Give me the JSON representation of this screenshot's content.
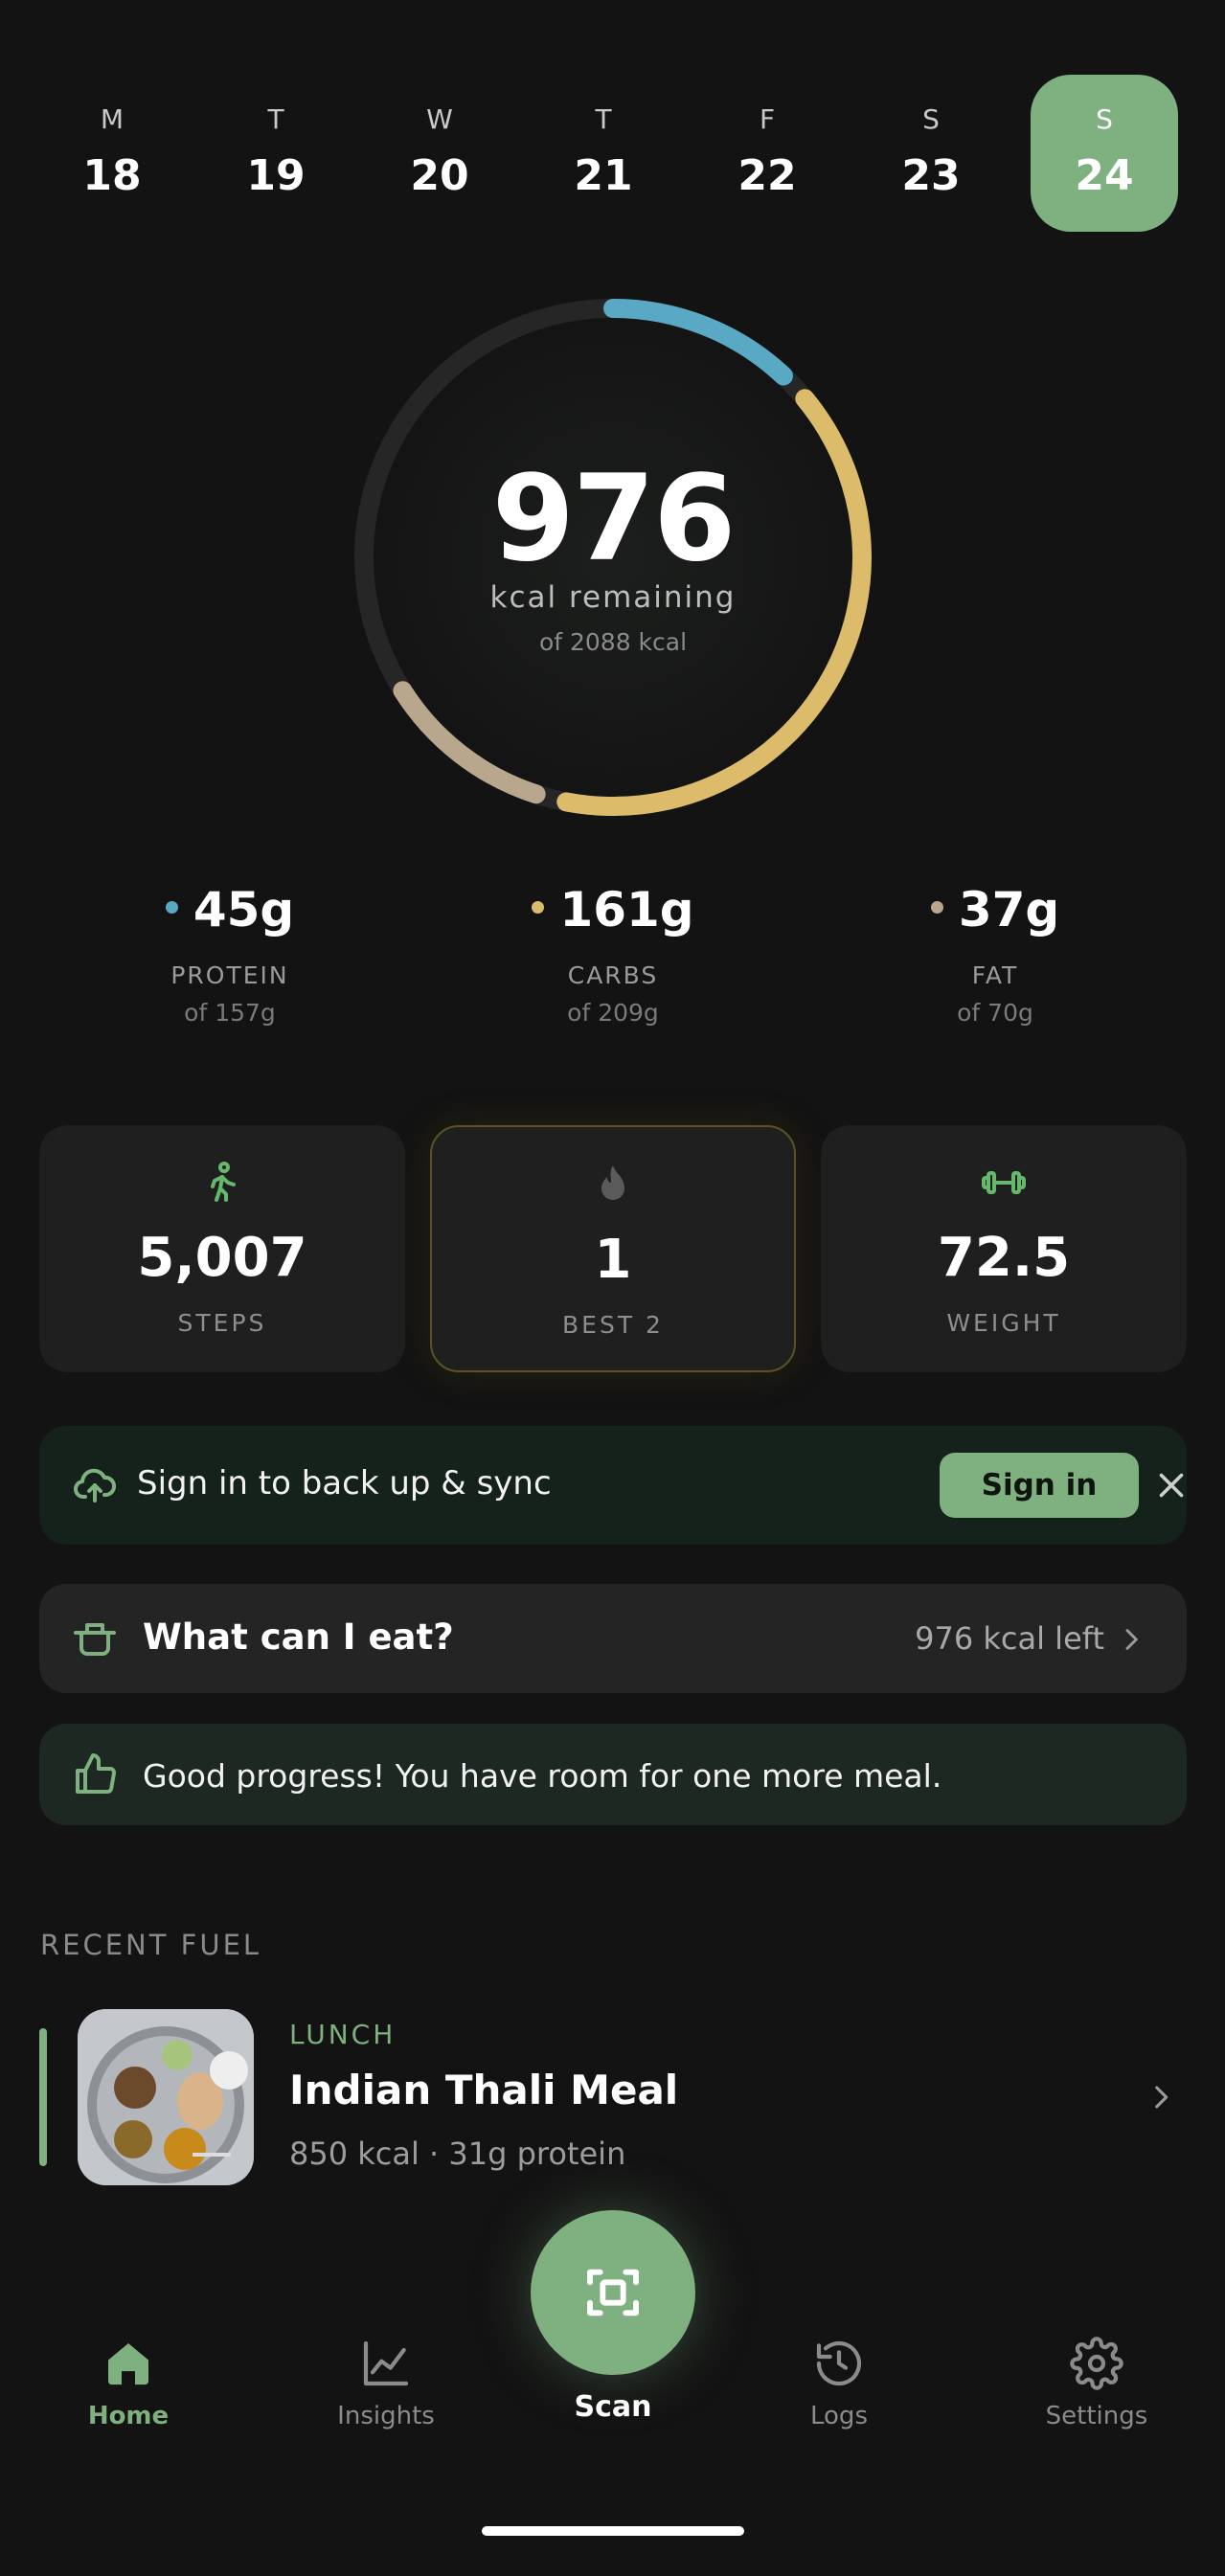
{
  "days": [
    {
      "letter": "M",
      "num": "18"
    },
    {
      "letter": "T",
      "num": "19"
    },
    {
      "letter": "W",
      "num": "20"
    },
    {
      "letter": "T",
      "num": "21"
    },
    {
      "letter": "F",
      "num": "22"
    },
    {
      "letter": "S",
      "num": "23"
    },
    {
      "letter": "S",
      "num": "24",
      "selected": true
    }
  ],
  "calories": {
    "remaining": "976",
    "label": "kcal remaining",
    "of": "of 2088 kcal",
    "goal_kcal": 2088,
    "consumed_fraction": {
      "protein": 0.12,
      "carbs": 0.39,
      "fat": 0.11
    }
  },
  "macros": [
    {
      "value": "45g",
      "name": "PROTEIN",
      "of": "of 157g",
      "color": "#5aa9c4"
    },
    {
      "value": "161g",
      "name": "CARBS",
      "of": "of 209g",
      "color": "#dcbc6a"
    },
    {
      "value": "37g",
      "name": "FAT",
      "of": "of 70g",
      "color": "#b8a68d"
    }
  ],
  "stats": [
    {
      "icon": "walking-person-icon",
      "value": "5,007",
      "label": "STEPS",
      "color": "#66b86a"
    },
    {
      "icon": "flame-icon",
      "value": "1",
      "label": "BEST 2",
      "color": "#5a5a5a"
    },
    {
      "icon": "dumbbell-icon",
      "value": "72.5",
      "label": "WEIGHT",
      "color": "#66b86a"
    }
  ],
  "sync_banner": {
    "text": "Sign in to back up & sync",
    "button": "Sign in"
  },
  "eat_card": {
    "title": "What can I eat?",
    "right": "976 kcal left"
  },
  "progress_msg": {
    "text": "Good progress! You have room for one more meal."
  },
  "recent": {
    "section": "RECENT FUEL",
    "items": [
      {
        "meal": "LUNCH",
        "title": "Indian Thali Meal",
        "sub": "850 kcal · 31g protein"
      }
    ]
  },
  "nav": {
    "home": "Home",
    "insights": "Insights",
    "scan": "Scan",
    "logs": "Logs",
    "settings": "Settings"
  },
  "colors": {
    "accent": "#7fb07f",
    "protein": "#5aa9c4",
    "carbs": "#dcbc6a",
    "fat": "#b8a68d"
  }
}
